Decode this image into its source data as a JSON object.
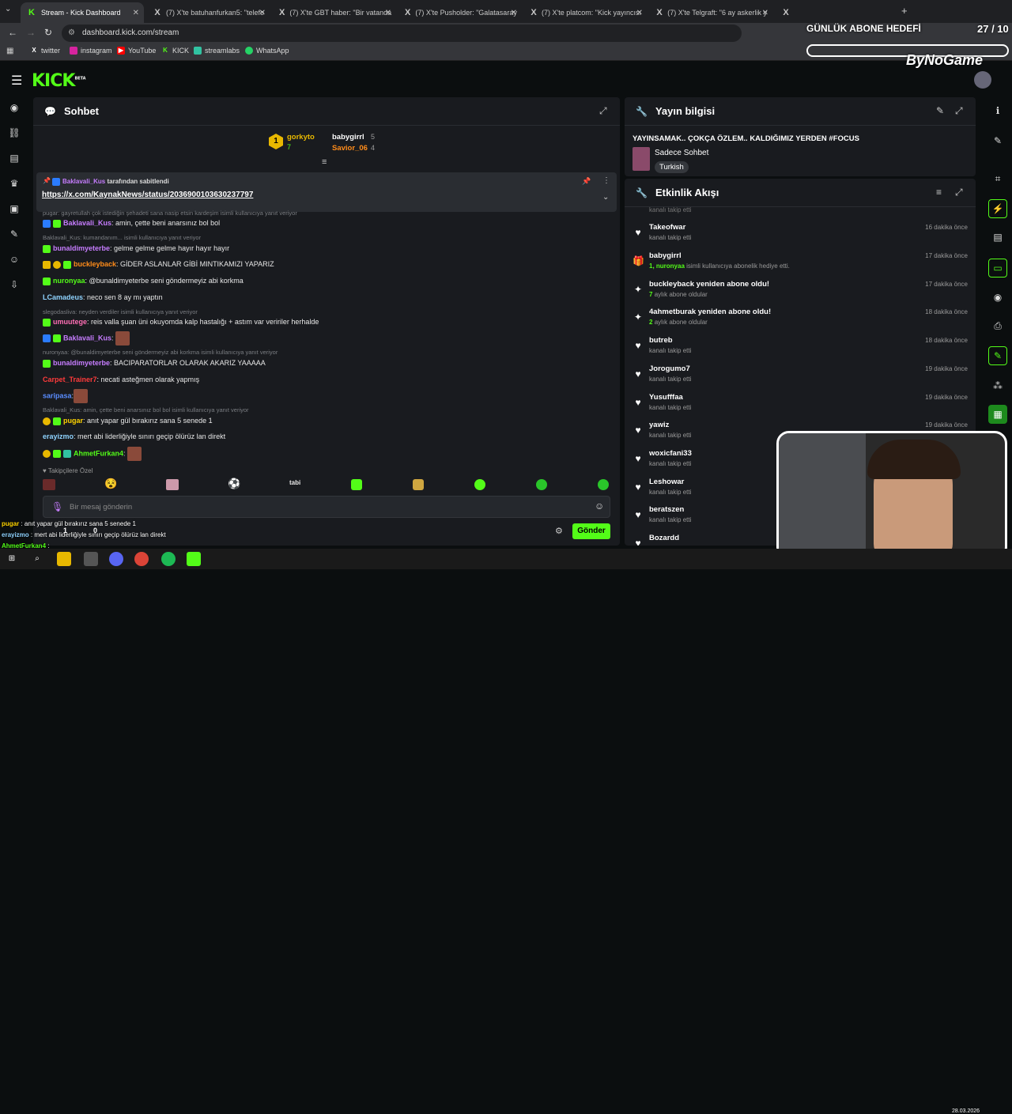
{
  "browser": {
    "tabs": [
      {
        "title": "Stream - Kick Dashboard",
        "icon": "kick-icon",
        "active": true
      },
      {
        "title": "(7) X'te batuhanfurkan5: \"telefo",
        "icon": "x-icon"
      },
      {
        "title": "(7) X'te GBT haber: \"Bir vatanda",
        "icon": "x-icon"
      },
      {
        "title": "(7) X'te Pusholder: \"Galatasaray",
        "icon": "x-icon"
      },
      {
        "title": "(7) X'te platcom: \"Kick yayıncısı",
        "icon": "x-icon"
      },
      {
        "title": "(7) X'te Telgraft: \"6 ay askerlik y",
        "icon": "x-icon"
      },
      {
        "title": "X",
        "icon": "x-icon"
      }
    ],
    "url": "dashboard.kick.com/stream",
    "bookmarks": [
      "twitter",
      "instagram",
      "YouTube",
      "KICK",
      "streamlabs",
      "WhatsApp"
    ]
  },
  "overlay": {
    "goal_label": "GÜNLÜK ABONE HEDEFİ",
    "goal_count": "27 / 10",
    "brand": "ByNoGame",
    "bottom_chat": [
      {
        "user": "pugar",
        "text": ": anıt yapar gül bırakırız sana 5 senede 1"
      },
      {
        "user": "erayizmo",
        "text": ": mert abi liderliğiyle sınırı geçip ölürüz lan direkt"
      },
      {
        "user": "AhmetFurkan4",
        "text": ":"
      }
    ],
    "bottom_counts": [
      "1",
      "0"
    ]
  },
  "kick": {
    "logo": "KICK",
    "logo_sup": "BETA"
  },
  "chat": {
    "title": "Sohbet",
    "top_gifters": [
      {
        "name": "gorkyto",
        "count": "7"
      },
      {
        "name": "babygirrl",
        "count": "5"
      },
      {
        "name": "Savior_06",
        "count": "4"
      }
    ],
    "pinned_by": "Baklavali_Kus",
    "pinned_by_suffix": "tarafından sabitlendi",
    "pinned_link": "https://x.com/KaynakNews/status/2036900103630237797",
    "messages": [
      {
        "reply": "pugar: gayretullah çok istediğin şehadeti sana nasip etsin kardeşim isimli kullanıcıya yanıt veriyor"
      },
      {
        "user": "Baklavali_Kus",
        "color": "#c77dff",
        "text": ": amin, çette beni anarsınız bol bol"
      },
      {
        "reply": "Baklavali_Kus: kumandanım... isimli kullanıcıya yanıt veriyor"
      },
      {
        "user": "bunaldimyeterbe",
        "color": "#c77dff",
        "text": ": gelme gelme gelme hayır hayır hayır"
      },
      {
        "user": "buckleyback",
        "color": "#ff8c1a",
        "text": ": GİDER ASLANLAR GİBİ MINTIKAMIZI YAPARIZ"
      },
      {
        "user": "nuronyaa",
        "color": "#53fc18",
        "text": ": @bunaldimyeterbe seni göndermeyiz abi korkma"
      },
      {
        "user": "LCamadeus",
        "color": "#8fd3ff",
        "text": ": neco sen 8 ay mı yaptın"
      },
      {
        "reply": "slegodasliva: neyden verdiler isimli kullanıcıya yanıt veriyor"
      },
      {
        "user": "umuutege",
        "color": "#ff6fb5",
        "text": ": reis valla şuan üni okuyomda kalp hastalığı + astım var veririler herhalde"
      },
      {
        "user": "Baklavali_Kus",
        "color": "#c77dff",
        "text": ":"
      },
      {
        "reply": "nuronyaa: @bunaldimyeterbe seni göndermeyiz abi korkma isimli kullanıcıya yanıt veriyor"
      },
      {
        "user": "bunaldimyeterbe",
        "color": "#c77dff",
        "text": ": BACIPARATORLAR OLARAK AKARIZ YAAAAA"
      },
      {
        "user": "Carpet_Trainer7",
        "color": "#ff3b3b",
        "text": ": necati asteğmen olarak yapmış"
      },
      {
        "user": "saripasa",
        "color": "#5a8dff",
        "text": ":"
      },
      {
        "reply": "Baklavali_Kus: amin, çette beni anarsınız bol bol isimli kullanıcıya yanıt veriyor"
      },
      {
        "user": "pugar",
        "color": "#ffd400",
        "text": ": anıt yapar gül bırakırız sana 5 senede 1"
      },
      {
        "user": "erayizmo",
        "color": "#8fd3ff",
        "text": ": mert abi liderliğiyle sınırı geçip ölürüz lan direkt"
      },
      {
        "user": "AhmetFurkan4",
        "color": "#53fc18",
        "text": ":"
      }
    ],
    "followers_only": "Takipçilere Özel",
    "input_placeholder": "Bir mesaj gönderin",
    "send_label": "Gönder"
  },
  "info": {
    "title": "Yayın bilgisi",
    "stream_title": "YAYINSAMAK.. ÇOKÇA ÖZLEM.. KALDIĞIMIZ YERDEN #FOCUS",
    "category": "Sadece Sohbet",
    "language": "Turkish"
  },
  "feed": {
    "title": "Etkinlik Akışı",
    "items": [
      {
        "name": "Takeofwar",
        "sub": "kanalı takip etti",
        "time": "16 dakika önce",
        "icon": "heart-icon"
      },
      {
        "name": "babygirrl",
        "sub_green": "1, nuronyaa",
        "sub": "isimli kullanıcıya abonelik hediye etti.",
        "time": "17 dakika önce",
        "icon": "gift-icon"
      },
      {
        "name": "buckleyback yeniden abone oldu!",
        "sub_green": "7",
        "sub": "aylık abone oldular",
        "time": "17 dakika önce",
        "icon": "sparkle-icon"
      },
      {
        "name": "4ahmetburak yeniden abone oldu!",
        "sub_green": "2",
        "sub": "aylık abone oldular",
        "time": "18 dakika önce",
        "icon": "sparkle-icon"
      },
      {
        "name": "butreb",
        "sub": "kanalı takip etti",
        "time": "18 dakika önce",
        "icon": "heart-icon"
      },
      {
        "name": "Jorogumo7",
        "sub": "kanalı takip etti",
        "time": "19 dakika önce",
        "icon": "heart-icon"
      },
      {
        "name": "Yusufffaa",
        "sub": "kanalı takip etti",
        "time": "19 dakika önce",
        "icon": "heart-icon"
      },
      {
        "name": "yawiz",
        "sub": "kanalı takip etti",
        "time": "19 dakika önce",
        "icon": "heart-icon"
      },
      {
        "name": "woxicfani33",
        "sub": "kanalı takip etti",
        "time": "",
        "icon": "heart-icon"
      },
      {
        "name": "Leshowar",
        "sub": "kanalı takip etti",
        "time": "",
        "icon": "heart-icon"
      },
      {
        "name": "beratszen",
        "sub": "kanalı takip etti",
        "time": "",
        "icon": "heart-icon"
      },
      {
        "name": "Bozardd",
        "sub": "",
        "time": "",
        "icon": "heart-icon"
      }
    ]
  },
  "taskbar": {
    "date": "28.03.2026"
  }
}
